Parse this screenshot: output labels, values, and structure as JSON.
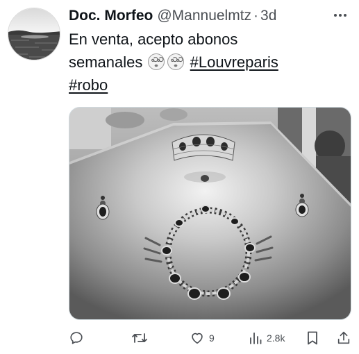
{
  "tweet": {
    "author_name": "Doc. Morfeo",
    "handle": "@Mannuelmtz",
    "separator": "·",
    "time": "3d",
    "text_line1": "En venta, acepto abonos",
    "text_line2_prefix": "semanales",
    "emoji_names": [
      "face-with-spiral-eyes",
      "face-with-spiral-eyes"
    ],
    "hashtag1": "#Louvreparis",
    "hashtag2": "#robo"
  },
  "media": {
    "description_icons": [
      "tiara",
      "necklace",
      "earring",
      "earring"
    ],
    "style": "black-and-white photo"
  },
  "actions": {
    "reply_count": "",
    "retweet_count": "",
    "like_count": "9",
    "views_count": "2.8k"
  },
  "icons": {
    "more": "more-icon",
    "reply": "reply-icon",
    "retweet": "retweet-icon",
    "like": "heart-icon",
    "views": "views-icon",
    "bookmark": "bookmark-icon",
    "share": "share-icon"
  },
  "colors": {
    "text": "#0f1419",
    "secondary": "#4b4f54",
    "border": "#cfd9de"
  }
}
